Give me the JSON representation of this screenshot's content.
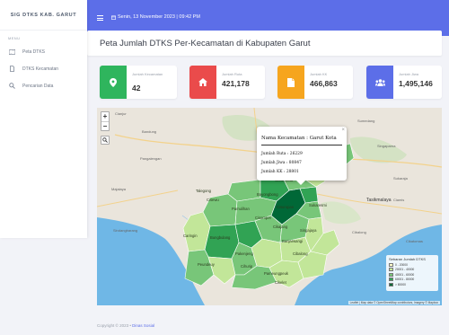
{
  "sidebar": {
    "brand": "SIG DTKS KAB. GARUT",
    "heading": "MENU",
    "items": [
      {
        "label": "Peta DTKS",
        "icon": "map-icon"
      },
      {
        "label": "DTKS Kecamatan",
        "icon": "file-icon"
      },
      {
        "label": "Pencarian Data",
        "icon": "search-icon"
      }
    ]
  },
  "topbar": {
    "datetime": "Senin, 13 November 2023 | 09:42 PM",
    "icons": [
      "menu-icon",
      "calendar-icon"
    ]
  },
  "page": {
    "title": "Peta Jumlah DTKS Per-Kecamatan di Kabupaten Garut"
  },
  "stats": [
    {
      "label": "Jumlah Kecamatan",
      "value": "42",
      "color": "#2fb55d",
      "icon": "map-pin-icon"
    },
    {
      "label": "Jumlah Ruta",
      "value": "421,178",
      "color": "#ea4b4b",
      "icon": "home-icon"
    },
    {
      "label": "Jumlah KK",
      "value": "466,863",
      "color": "#f6a51e",
      "icon": "document-icon"
    },
    {
      "label": "Jumlah Jiwa",
      "value": "1,495,146",
      "color": "#5c6ee8",
      "icon": "users-icon"
    }
  ],
  "map": {
    "zoom_in": "+",
    "zoom_out": "−",
    "popup": {
      "title": "Nama Kecamatan : Garut Kota",
      "rows": [
        "Jumlah Ruta : 26229",
        "Jumlah Jiwa : 80847",
        "Jumlah KK : 28801"
      ],
      "close": "×"
    },
    "places": [
      {
        "name": "Garut Kota"
      },
      {
        "name": "Tarogong"
      },
      {
        "name": "Cilawu"
      },
      {
        "name": "Cisurupan"
      },
      {
        "name": "Cikajang"
      },
      {
        "name": "Bayongbong"
      },
      {
        "name": "Banjarwangi"
      },
      {
        "name": "Pameungpeuk"
      },
      {
        "name": "Cibalong"
      },
      {
        "name": "Cisewu"
      },
      {
        "name": "Caringin"
      },
      {
        "name": "Bungbulang"
      },
      {
        "name": "Pakenjeng"
      },
      {
        "name": "Cikelet"
      },
      {
        "name": "Singajaya"
      },
      {
        "name": "Talegong"
      },
      {
        "name": "Pamulihan"
      },
      {
        "name": "Sukaresmi"
      },
      {
        "name": "Cihurip"
      },
      {
        "name": "Cisompet"
      },
      {
        "name": "Peundeuy"
      },
      {
        "name": "Malangbong"
      }
    ],
    "base_labels": [
      {
        "name": "Pangalengan"
      },
      {
        "name": "Bandung"
      },
      {
        "name": "Sumedang"
      },
      {
        "name": "Tasikmalaya"
      },
      {
        "name": "Singaparna"
      },
      {
        "name": "Ciamis"
      },
      {
        "name": "Cianjur"
      },
      {
        "name": "Sindangbarang"
      },
      {
        "name": "Cibalong"
      },
      {
        "name": "Sukaraja"
      },
      {
        "name": "Cikatomas"
      },
      {
        "name": "Majalaya"
      }
    ],
    "legend": {
      "title": "Sebaran Jumlah DTKS",
      "items": [
        {
          "label": "0 - 20000",
          "color": "#ffffcc"
        },
        {
          "label": "20001 - 40000",
          "color": "#c2e699"
        },
        {
          "label": "40001 - 60000",
          "color": "#78c679"
        },
        {
          "label": "60001 - 80000",
          "color": "#31a354"
        },
        {
          "label": "> 80000",
          "color": "#006837"
        }
      ]
    },
    "attribution": "Leaflet | Map data © OpenStreetMap contributors, Imagery © Mapbox"
  },
  "footer": {
    "text": "Copyright © 2023",
    "link": "Dinas Sosial"
  }
}
